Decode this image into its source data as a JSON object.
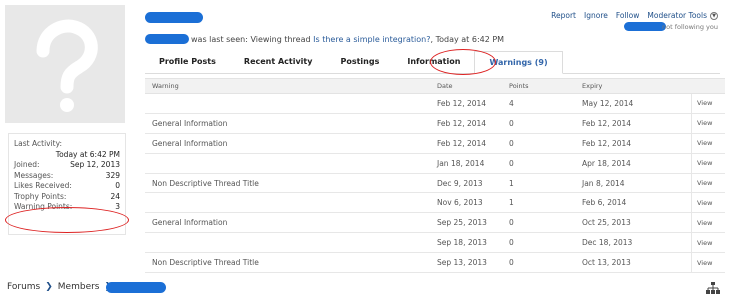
{
  "profile": {
    "last_seen_text": "was last seen:",
    "viewing_label": "Viewing thread",
    "thread_title": "Is there a simple integration?",
    "time_suffix": ", Today at 6:42 PM"
  },
  "actions": {
    "report": "Report",
    "ignore": "Ignore",
    "follow": "Follow",
    "moderator_tools": "Moderator Tools",
    "follow_status": "not following you"
  },
  "stats": {
    "last_activity_label": "Last Activity:",
    "last_activity_value": "Today at 6:42 PM",
    "joined_label": "Joined:",
    "joined_value": "Sep 12, 2013",
    "messages_label": "Messages:",
    "messages_value": "329",
    "likes_label": "Likes Received:",
    "likes_value": "0",
    "trophy_label": "Trophy Points:",
    "trophy_value": "24",
    "warning_label": "Warning Points:",
    "warning_value": "3"
  },
  "tabs": [
    {
      "label": "Profile Posts"
    },
    {
      "label": "Recent Activity"
    },
    {
      "label": "Postings"
    },
    {
      "label": "Information"
    },
    {
      "label": "Warnings (9)"
    }
  ],
  "table": {
    "headers": {
      "warning": "Warning",
      "date": "Date",
      "points": "Points",
      "expiry": "Expiry"
    },
    "view_label": "View",
    "rows": [
      {
        "warning": "",
        "date": "Feb 12, 2014",
        "points": "4",
        "expiry": "May 12, 2014"
      },
      {
        "warning": "General Information",
        "date": "Feb 12, 2014",
        "points": "0",
        "expiry": "Feb 12, 2014"
      },
      {
        "warning": "General Information",
        "date": "Feb 12, 2014",
        "points": "0",
        "expiry": "Feb 12, 2014"
      },
      {
        "warning": "",
        "date": "Jan 18, 2014",
        "points": "0",
        "expiry": "Apr 18, 2014"
      },
      {
        "warning": "Non Descriptive Thread Title",
        "date": "Dec 9, 2013",
        "points": "1",
        "expiry": "Jan 8, 2014"
      },
      {
        "warning": "",
        "date": "Nov 6, 2013",
        "points": "1",
        "expiry": "Feb 6, 2014"
      },
      {
        "warning": "General Information",
        "date": "Sep 25, 2013",
        "points": "0",
        "expiry": "Oct 25, 2013"
      },
      {
        "warning": "",
        "date": "Sep 18, 2013",
        "points": "0",
        "expiry": "Dec 18, 2013"
      },
      {
        "warning": "Non Descriptive Thread Title",
        "date": "Sep 13, 2013",
        "points": "0",
        "expiry": "Oct 13, 2013"
      }
    ]
  },
  "breadcrumb": {
    "forums": "Forums",
    "members": "Members"
  },
  "colors": {
    "redaction": "#1b6fd6",
    "annotation_ring": "#dd2222",
    "link": "#2b5c9a"
  },
  "icons": {
    "avatar": "question-mark-avatar",
    "breadcrumb_separator": "chevron-right-icon",
    "sitemap": "sitemap-icon",
    "mod_tools_menu": "chevron-down-icon"
  }
}
